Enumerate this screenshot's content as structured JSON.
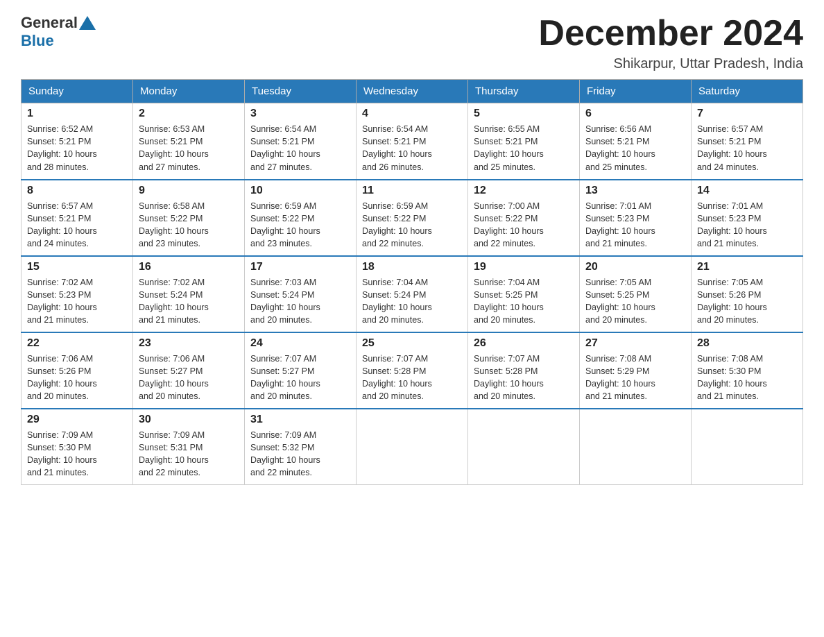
{
  "header": {
    "logo_general": "General",
    "logo_blue": "Blue",
    "month_title": "December 2024",
    "subtitle": "Shikarpur, Uttar Pradesh, India"
  },
  "weekdays": [
    "Sunday",
    "Monday",
    "Tuesday",
    "Wednesday",
    "Thursday",
    "Friday",
    "Saturday"
  ],
  "weeks": [
    [
      {
        "day": "1",
        "sunrise": "6:52 AM",
        "sunset": "5:21 PM",
        "daylight": "10 hours and 28 minutes."
      },
      {
        "day": "2",
        "sunrise": "6:53 AM",
        "sunset": "5:21 PM",
        "daylight": "10 hours and 27 minutes."
      },
      {
        "day": "3",
        "sunrise": "6:54 AM",
        "sunset": "5:21 PM",
        "daylight": "10 hours and 27 minutes."
      },
      {
        "day": "4",
        "sunrise": "6:54 AM",
        "sunset": "5:21 PM",
        "daylight": "10 hours and 26 minutes."
      },
      {
        "day": "5",
        "sunrise": "6:55 AM",
        "sunset": "5:21 PM",
        "daylight": "10 hours and 25 minutes."
      },
      {
        "day": "6",
        "sunrise": "6:56 AM",
        "sunset": "5:21 PM",
        "daylight": "10 hours and 25 minutes."
      },
      {
        "day": "7",
        "sunrise": "6:57 AM",
        "sunset": "5:21 PM",
        "daylight": "10 hours and 24 minutes."
      }
    ],
    [
      {
        "day": "8",
        "sunrise": "6:57 AM",
        "sunset": "5:21 PM",
        "daylight": "10 hours and 24 minutes."
      },
      {
        "day": "9",
        "sunrise": "6:58 AM",
        "sunset": "5:22 PM",
        "daylight": "10 hours and 23 minutes."
      },
      {
        "day": "10",
        "sunrise": "6:59 AM",
        "sunset": "5:22 PM",
        "daylight": "10 hours and 23 minutes."
      },
      {
        "day": "11",
        "sunrise": "6:59 AM",
        "sunset": "5:22 PM",
        "daylight": "10 hours and 22 minutes."
      },
      {
        "day": "12",
        "sunrise": "7:00 AM",
        "sunset": "5:22 PM",
        "daylight": "10 hours and 22 minutes."
      },
      {
        "day": "13",
        "sunrise": "7:01 AM",
        "sunset": "5:23 PM",
        "daylight": "10 hours and 21 minutes."
      },
      {
        "day": "14",
        "sunrise": "7:01 AM",
        "sunset": "5:23 PM",
        "daylight": "10 hours and 21 minutes."
      }
    ],
    [
      {
        "day": "15",
        "sunrise": "7:02 AM",
        "sunset": "5:23 PM",
        "daylight": "10 hours and 21 minutes."
      },
      {
        "day": "16",
        "sunrise": "7:02 AM",
        "sunset": "5:24 PM",
        "daylight": "10 hours and 21 minutes."
      },
      {
        "day": "17",
        "sunrise": "7:03 AM",
        "sunset": "5:24 PM",
        "daylight": "10 hours and 20 minutes."
      },
      {
        "day": "18",
        "sunrise": "7:04 AM",
        "sunset": "5:24 PM",
        "daylight": "10 hours and 20 minutes."
      },
      {
        "day": "19",
        "sunrise": "7:04 AM",
        "sunset": "5:25 PM",
        "daylight": "10 hours and 20 minutes."
      },
      {
        "day": "20",
        "sunrise": "7:05 AM",
        "sunset": "5:25 PM",
        "daylight": "10 hours and 20 minutes."
      },
      {
        "day": "21",
        "sunrise": "7:05 AM",
        "sunset": "5:26 PM",
        "daylight": "10 hours and 20 minutes."
      }
    ],
    [
      {
        "day": "22",
        "sunrise": "7:06 AM",
        "sunset": "5:26 PM",
        "daylight": "10 hours and 20 minutes."
      },
      {
        "day": "23",
        "sunrise": "7:06 AM",
        "sunset": "5:27 PM",
        "daylight": "10 hours and 20 minutes."
      },
      {
        "day": "24",
        "sunrise": "7:07 AM",
        "sunset": "5:27 PM",
        "daylight": "10 hours and 20 minutes."
      },
      {
        "day": "25",
        "sunrise": "7:07 AM",
        "sunset": "5:28 PM",
        "daylight": "10 hours and 20 minutes."
      },
      {
        "day": "26",
        "sunrise": "7:07 AM",
        "sunset": "5:28 PM",
        "daylight": "10 hours and 20 minutes."
      },
      {
        "day": "27",
        "sunrise": "7:08 AM",
        "sunset": "5:29 PM",
        "daylight": "10 hours and 21 minutes."
      },
      {
        "day": "28",
        "sunrise": "7:08 AM",
        "sunset": "5:30 PM",
        "daylight": "10 hours and 21 minutes."
      }
    ],
    [
      {
        "day": "29",
        "sunrise": "7:09 AM",
        "sunset": "5:30 PM",
        "daylight": "10 hours and 21 minutes."
      },
      {
        "day": "30",
        "sunrise": "7:09 AM",
        "sunset": "5:31 PM",
        "daylight": "10 hours and 22 minutes."
      },
      {
        "day": "31",
        "sunrise": "7:09 AM",
        "sunset": "5:32 PM",
        "daylight": "10 hours and 22 minutes."
      },
      null,
      null,
      null,
      null
    ]
  ],
  "labels": {
    "sunrise": "Sunrise:",
    "sunset": "Sunset:",
    "daylight": "Daylight:"
  }
}
